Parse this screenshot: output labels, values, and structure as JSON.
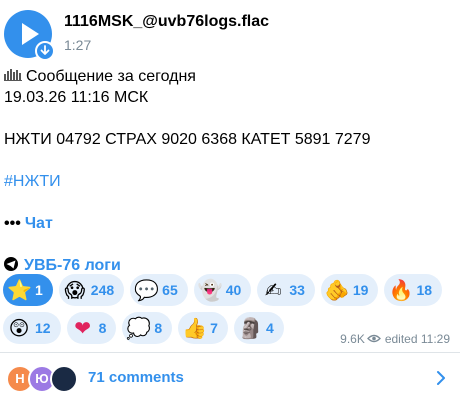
{
  "audio": {
    "file_name": "1116MSK_@uvb76logs.flac",
    "duration": "1:27"
  },
  "message": {
    "line1": "Сообщение за сегодня",
    "line2": "19.03.26 11:16 МСК",
    "line3": "НЖТИ 04792 СТРАХ 9020 6368 КАТЕТ 5891 7279",
    "hashtag": "#НЖТИ",
    "chat_link": "Чат",
    "channel_link": "УВБ-76 логи"
  },
  "reactions": [
    {
      "emoji": "⭐",
      "count": "1",
      "mine": true
    },
    {
      "emoji": "😱",
      "count": "248"
    },
    {
      "emoji": "💬",
      "count": "65"
    },
    {
      "emoji": "👻",
      "count": "40"
    },
    {
      "emoji": "✍",
      "count": "33"
    },
    {
      "emoji": "🫵",
      "count": "19"
    },
    {
      "emoji": "🔥",
      "count": "18"
    },
    {
      "emoji": "😲",
      "count": "12"
    },
    {
      "emoji": "❤",
      "count": "8"
    },
    {
      "emoji": "💭",
      "count": "8"
    },
    {
      "emoji": "👍",
      "count": "7"
    },
    {
      "emoji": "🗿",
      "count": "4"
    }
  ],
  "meta": {
    "views": "9.6K",
    "edited": "edited 11:29"
  },
  "comments": {
    "avatar1_letter": "Н",
    "avatar2_letter": "Ю",
    "label": "71 comments"
  },
  "colors": {
    "accent": "#3390ec",
    "reaction_bg": "#e4effb",
    "muted": "#7a8a96"
  }
}
